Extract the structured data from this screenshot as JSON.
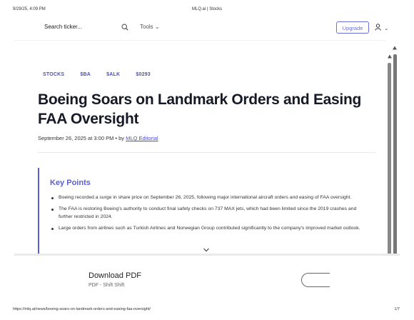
{
  "print_header": {
    "date": "9/29/25, 4:09 PM",
    "title": "MLQ.ai | Stocks"
  },
  "nav": {
    "search_placeholder": "Search ticker...",
    "tools_label": "Tools",
    "upgrade_label": "Upgrade"
  },
  "article": {
    "tags": [
      "STOCKS",
      "$BA",
      "$ALK",
      "$0293"
    ],
    "title": "Boeing Soars on Landmark Orders and Easing FAA Oversight",
    "date": "September 26, 2025 at 3:00 PM",
    "by": "• by",
    "author": "MLQ Editorial",
    "key_points_title": "Key Points",
    "key_points": [
      "Boeing recorded a surge in share price on September 26, 2025, following major international aircraft orders and easing of FAA oversight.",
      "The FAA is restoring Boeing's authority to conduct final safety checks on 737 MAX jets, which had been limited since the 2019 crashes and further restricted in 2024.",
      "Large orders from airlines such as Turkish Airlines and Norwegian Group contributed significantly to the company's improved market outlook."
    ]
  },
  "pdf_bar": {
    "title": "Download PDF",
    "subtitle": "PDF - Shift Shift"
  },
  "print_footer": {
    "url": "https://mlq.ai/news/boeing-soars-on-landmark-orders-and-easing-faa-oversight/",
    "page": "1/7"
  },
  "colors": {
    "accent": "#5a5ed0",
    "text": "#161a26"
  }
}
